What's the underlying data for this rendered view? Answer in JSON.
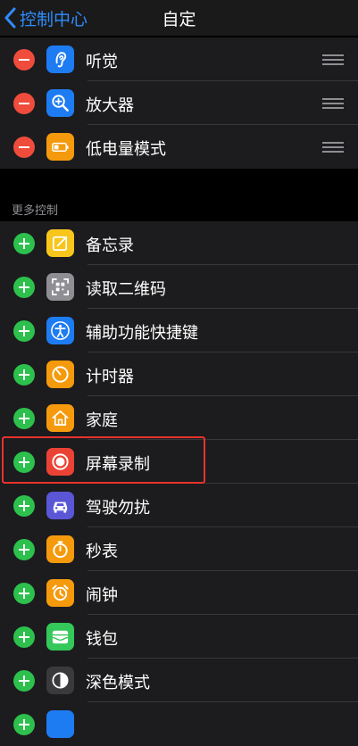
{
  "nav": {
    "back_label": "控制中心",
    "title": "自定"
  },
  "included": [
    {
      "label": "听觉",
      "icon": "ear-icon",
      "color": "#1e7cf2"
    },
    {
      "label": "放大器",
      "icon": "magnifier-icon",
      "color": "#1e7cf2"
    },
    {
      "label": "低电量模式",
      "icon": "battery-icon",
      "color": "#f59a0c"
    }
  ],
  "more_header": "更多控制",
  "more": [
    {
      "label": "备忘录",
      "icon": "notes-icon",
      "color": "#f7c51c"
    },
    {
      "label": "读取二维码",
      "icon": "qr-code-icon",
      "color": "#8e8e93"
    },
    {
      "label": "辅助功能快捷键",
      "icon": "accessibility-icon",
      "color": "#1e7cf2"
    },
    {
      "label": "计时器",
      "icon": "timer-icon",
      "color": "#f59a0c"
    },
    {
      "label": "家庭",
      "icon": "home-icon",
      "color": "#f59a0c"
    },
    {
      "label": "屏幕录制",
      "icon": "screen-record-icon",
      "color": "#ea4335"
    },
    {
      "label": "驾驶勿扰",
      "icon": "car-icon",
      "color": "#5a56d6"
    },
    {
      "label": "秒表",
      "icon": "stopwatch-icon",
      "color": "#f59a0c"
    },
    {
      "label": "闹钟",
      "icon": "alarm-icon",
      "color": "#f59a0c"
    },
    {
      "label": "钱包",
      "icon": "wallet-icon",
      "color": "#34c759"
    },
    {
      "label": "深色模式",
      "icon": "dark-mode-icon",
      "color": "#3a3a3c"
    },
    {
      "label": "",
      "icon": "partial-icon",
      "color": "#1e7cf2"
    }
  ]
}
